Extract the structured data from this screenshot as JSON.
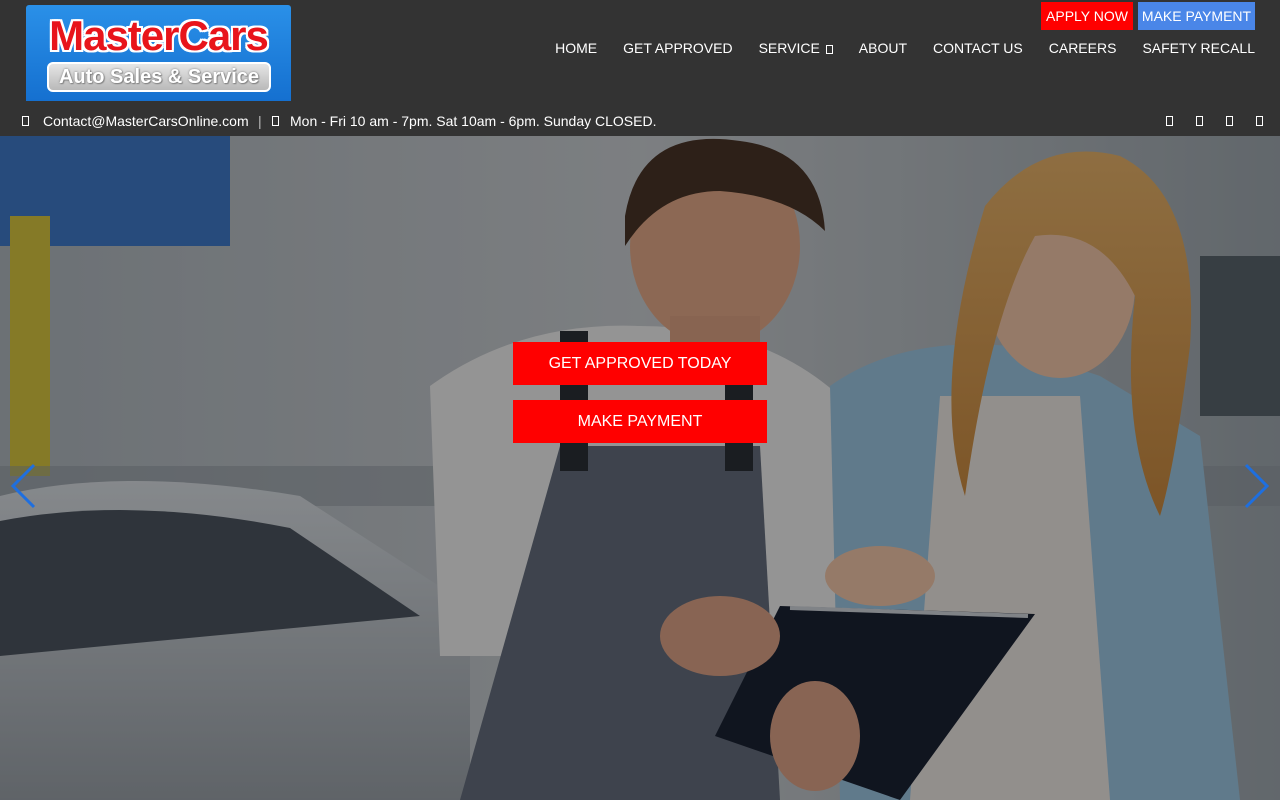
{
  "brand": {
    "title": "MasterCars",
    "subtitle": "Auto Sales & Service",
    "logo_color": "#1a7ee0",
    "title_color": "#e8141b"
  },
  "top_buttons": {
    "apply": "APPLY NOW",
    "payment": "MAKE PAYMENT"
  },
  "nav": {
    "items": [
      {
        "label": "HOME"
      },
      {
        "label": "GET APPROVED"
      },
      {
        "label": "SERVICE",
        "has_dropdown": true
      },
      {
        "label": "ABOUT"
      },
      {
        "label": "CONTACT US"
      },
      {
        "label": "CAREERS"
      },
      {
        "label": "SAFETY RECALL"
      }
    ]
  },
  "info_bar": {
    "email": "Contact@MasterCarsOnline.com",
    "separator": "|",
    "hours": "Mon - Fri 10 am - 7pm. Sat 10am - 6pm. Sunday CLOSED.",
    "email_icon": "envelope-icon",
    "hours_icon": "clock-icon",
    "social_icons": [
      "facebook-icon",
      "twitter-icon",
      "instagram-icon",
      "youtube-icon"
    ]
  },
  "hero": {
    "cta_primary": "GET APPROVED TODAY",
    "cta_secondary": "MAKE PAYMENT",
    "prev_icon": "chevron-left-icon",
    "next_icon": "chevron-right-icon",
    "accent": "#ff0000",
    "arrow_color": "#1e6fe0"
  },
  "colors": {
    "header_bg": "#333333",
    "apply_btn": "#ff0000",
    "payment_btn": "#4a86e8"
  }
}
